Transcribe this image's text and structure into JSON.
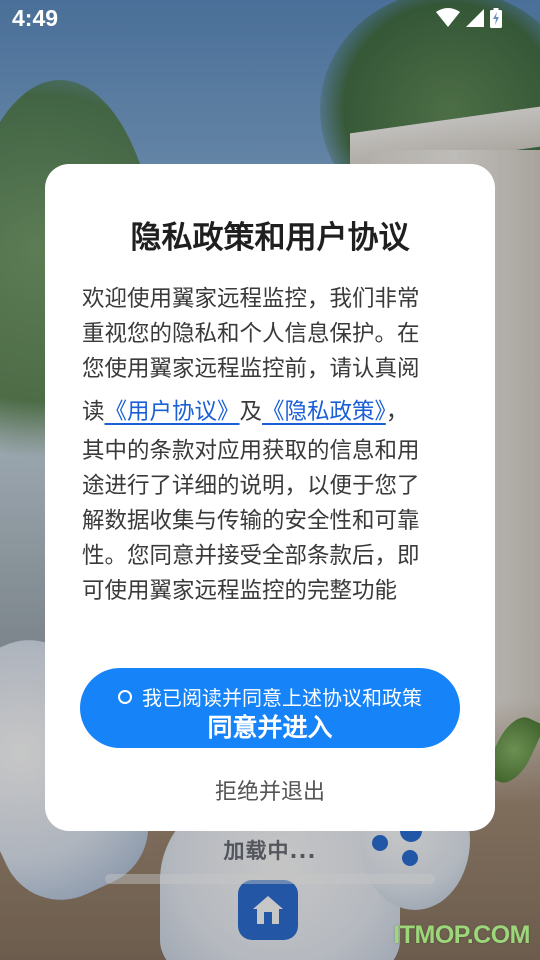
{
  "status_bar": {
    "time": "4:49",
    "icons": [
      "wifi-icon",
      "signal-icon",
      "battery-charging-icon"
    ]
  },
  "background": {
    "loading_text": "加载中..."
  },
  "dialog": {
    "title": "隐私政策和用户协议",
    "body": {
      "line1": "欢迎使用翼家远程监控，我们非常",
      "line2": "重视您的隐私和个人信息保护。在",
      "line3": "您使用翼家远程监控前，请认真阅",
      "line4_prefix": "读",
      "user_agreement_link": "《用户协议》",
      "line4_mid": "及",
      "privacy_policy_link": "《隐私政策》",
      "line4_suffix": "，",
      "line5": "其中的条款对应用获取的信息和用",
      "line6": "途进行了详细的说明，以便于您了",
      "line7": "解数据收集与传输的安全性和可靠",
      "line8": "性。您同意并接受全部条款后，即",
      "line9": "可使用翼家远程监控的完整功能"
    },
    "consent_checkbox_label": "我已阅读并同意上述协议和政策",
    "agree_button_label": "同意并进入",
    "reject_label": "拒绝并退出"
  },
  "watermark": "ITMOP.COM",
  "colors": {
    "accent": "#1683f8",
    "link": "#1a5fd8",
    "dialog_bg": "#ffffff",
    "watermark": "#9cd77a"
  }
}
